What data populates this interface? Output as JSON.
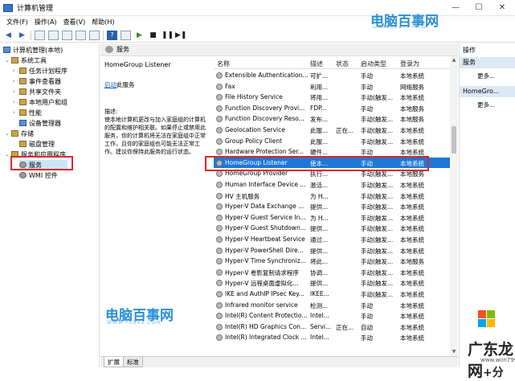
{
  "window": {
    "title": "计算机管理",
    "minimize": "—",
    "maximize": "☐",
    "close": "✕"
  },
  "menu": [
    "文件(F)",
    "操作(A)",
    "查看(V)",
    "帮助(H)"
  ],
  "watermark": {
    "top_text": "电脑百事网",
    "top_url": "WWW.PC841.COM",
    "bottom_text": "电脑百事网",
    "bottom_url": "WWW.PC841.COM"
  },
  "tree": {
    "root": "计算机管理(本地)",
    "items": [
      {
        "label": "系统工具",
        "level": 1
      },
      {
        "label": "任务计划程序",
        "level": 2
      },
      {
        "label": "事件查看器",
        "level": 2
      },
      {
        "label": "共享文件夹",
        "level": 2
      },
      {
        "label": "本地用户和组",
        "level": 2
      },
      {
        "label": "性能",
        "level": 2
      },
      {
        "label": "设备管理器",
        "level": 2
      },
      {
        "label": "存储",
        "level": 1
      },
      {
        "label": "磁盘管理",
        "level": 2
      },
      {
        "label": "服务和应用程序",
        "level": 1
      },
      {
        "label": "服务",
        "level": 2
      },
      {
        "label": "WMI 控件",
        "level": 2
      }
    ]
  },
  "content_header": "服务",
  "description": {
    "title": "HomeGroup Listener",
    "link": "启动",
    "link_suffix": "此服务",
    "label": "描述:",
    "body": "使本地计算机更改与加入家庭组的计算机的配置和维护相关联。如果停止或禁用此服务，你的计算机将无法在家庭组中正常工作，且你的家庭组也可能无法正常工作。建议你保持此服务的运行状态。"
  },
  "columns": [
    "名称",
    "描述",
    "状态",
    "启动类型",
    "登录为"
  ],
  "services": [
    [
      "Extensible Authentication...",
      "可扩...",
      "",
      "手动",
      "本地系统"
    ],
    [
      "Fax",
      "利用...",
      "",
      "手动",
      "网络服务"
    ],
    [
      "File History Service",
      "将用...",
      "",
      "手动(触发...",
      "本地系统"
    ],
    [
      "Function Discovery Provi...",
      "FDP...",
      "",
      "手动",
      "本地服务"
    ],
    [
      "Function Discovery Reso...",
      "发布...",
      "",
      "手动(触发...",
      "本地服务"
    ],
    [
      "Geolocation Service",
      "此服...",
      "正在...",
      "手动(触发...",
      "本地系统"
    ],
    [
      "Group Policy Client",
      "此服...",
      "",
      "手动(触发...",
      "本地系统"
    ],
    [
      "Hardware Protection Ser...",
      "硬件...",
      "",
      "手动",
      "本地系统"
    ],
    [
      "HomeGroup Listener",
      "使本...",
      "",
      "手动",
      "本地系统"
    ],
    [
      "HomeGroup Provider",
      "执行...",
      "",
      "手动(触发...",
      "本地服务"
    ],
    [
      "Human Interface Device ...",
      "激活...",
      "",
      "手动(触发...",
      "本地系统"
    ],
    [
      "HV 主机服务",
      "为 H...",
      "",
      "手动(触发...",
      "本地系统"
    ],
    [
      "Hyper-V Data Exchange ...",
      "提供...",
      "",
      "手动(触发...",
      "本地系统"
    ],
    [
      "Hyper-V Guest Service In...",
      "为 H...",
      "",
      "手动(触发...",
      "本地系统"
    ],
    [
      "Hyper-V Guest Shutdown...",
      "提供...",
      "",
      "手动(触发...",
      "本地系统"
    ],
    [
      "Hyper-V Heartbeat Service",
      "通过...",
      "",
      "手动(触发...",
      "本地系统"
    ],
    [
      "Hyper-V PowerShell Dire...",
      "提供...",
      "",
      "手动(触发...",
      "本地系统"
    ],
    [
      "Hyper-V Time Synchroniz...",
      "将此...",
      "",
      "手动(触发...",
      "本地服务"
    ],
    [
      "Hyper-V 卷影复制请求程序",
      "协调...",
      "",
      "手动(触发...",
      "本地系统"
    ],
    [
      "Hyper-V 远程桌面虚拟化...",
      "提供...",
      "",
      "手动(触发...",
      "本地系统"
    ],
    [
      "IKE and AuthIP IPsec Key...",
      "IKEE...",
      "",
      "手动(触发...",
      "本地系统"
    ],
    [
      "Infrared monitor service",
      "检测...",
      "",
      "手动",
      "本地系统"
    ],
    [
      "Intel(R) Content Protectio...",
      "Intel...",
      "",
      "手动",
      "本地系统"
    ],
    [
      "Intel(R) HD Graphics Con...",
      "Servi...",
      "正在...",
      "自动",
      "本地系统"
    ],
    [
      "Intel(R) Integrated Clock ...",
      "Intel...",
      "",
      "手动",
      "本地系统"
    ]
  ],
  "selected_index": 8,
  "actions": {
    "header": "操作",
    "sections": [
      {
        "title": "服务",
        "more": "更多..."
      },
      {
        "title": "HomeGro...",
        "more": "更多..."
      }
    ]
  },
  "tabs": [
    "扩展",
    "标准"
  ],
  "brand": {
    "name": "广东龙网",
    "suffix": "+分",
    "url": "www.wiin7999.com"
  },
  "colors": {
    "selection": "#1e78d6",
    "highlight_box": "#d42a2a",
    "watermark": "#2a8fd6"
  }
}
